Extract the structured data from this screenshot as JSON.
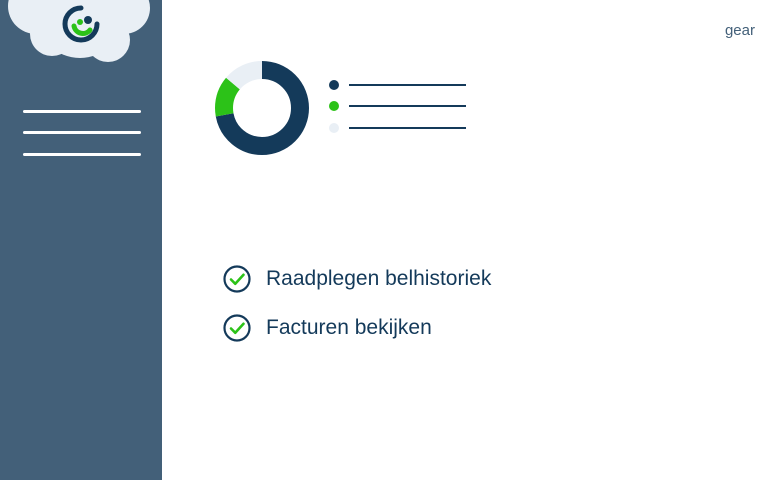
{
  "header": {
    "gear_label": "gear"
  },
  "brand": {
    "logo_icon": "brand-logo-icon"
  },
  "sidebar": {
    "menu_icon": "hamburger-menu-icon"
  },
  "summary": {
    "segments": [
      {
        "name": "",
        "share": 0.72,
        "color": "#143a5a"
      },
      {
        "name": "",
        "share": 0.14,
        "color": "#2cc218"
      },
      {
        "name": "",
        "share": 0.14,
        "color": "#e9eff5"
      }
    ]
  },
  "features": [
    {
      "label": "Raadplegen belhistoriek",
      "icon": "check-circle-icon"
    },
    {
      "label": "Facturen bekijken",
      "icon": "check-circle-icon"
    }
  ],
  "colors": {
    "sidebar": "#436079",
    "navy": "#143a5a",
    "accent_green": "#2cc218",
    "light": "#e9eff5"
  }
}
